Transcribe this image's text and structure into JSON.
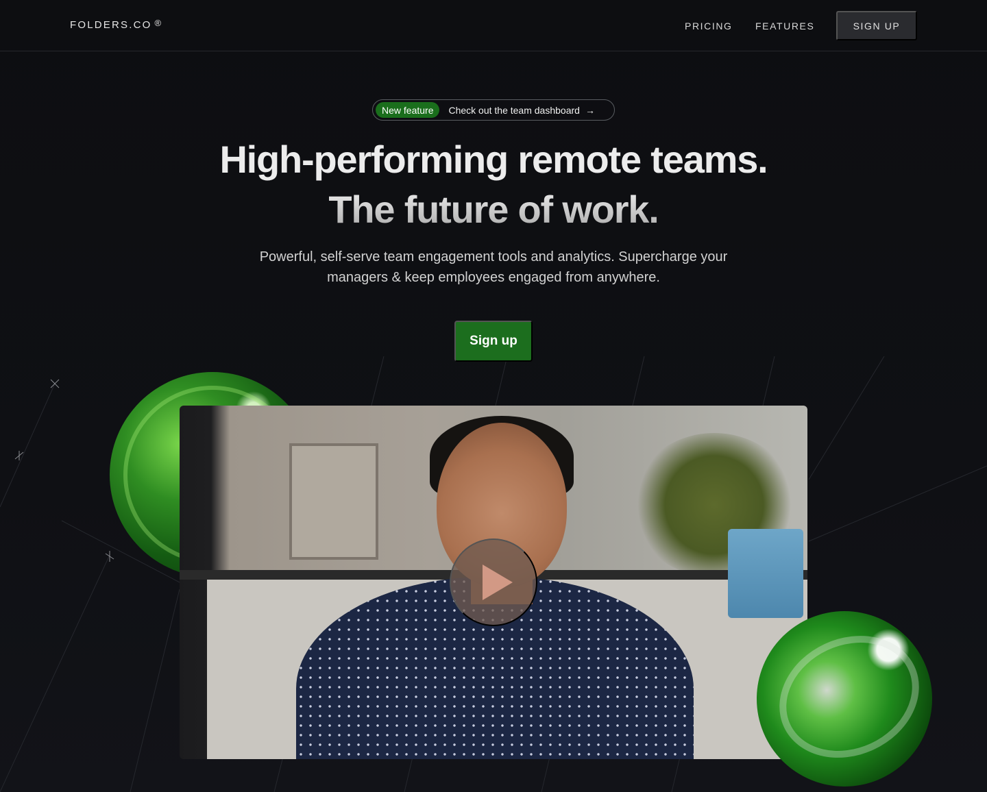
{
  "nav": {
    "logo": "FOLDERS.CO",
    "logo_mark": "®",
    "pricing": "PRICING",
    "features": "FEATURES",
    "signup": "SIGN UP"
  },
  "announcement": {
    "tag": "New feature",
    "text": "Check out the team dashboard",
    "arrow": "→"
  },
  "hero": {
    "headline_1": "High-performing remote teams.",
    "headline_2": "The future of work.",
    "subtitle": "Powerful, self-serve team engagement tools and analytics. Supercharge your managers & keep employees engaged from anywhere.",
    "cta": "Sign up"
  },
  "media": {
    "video_icon": "play-icon",
    "decor_left": "green-sphere",
    "decor_right": "green-sphere"
  },
  "colors": {
    "background": "#0e0f12",
    "accent_green": "#1c6e1e",
    "nav_button": "#2a2b2f"
  }
}
